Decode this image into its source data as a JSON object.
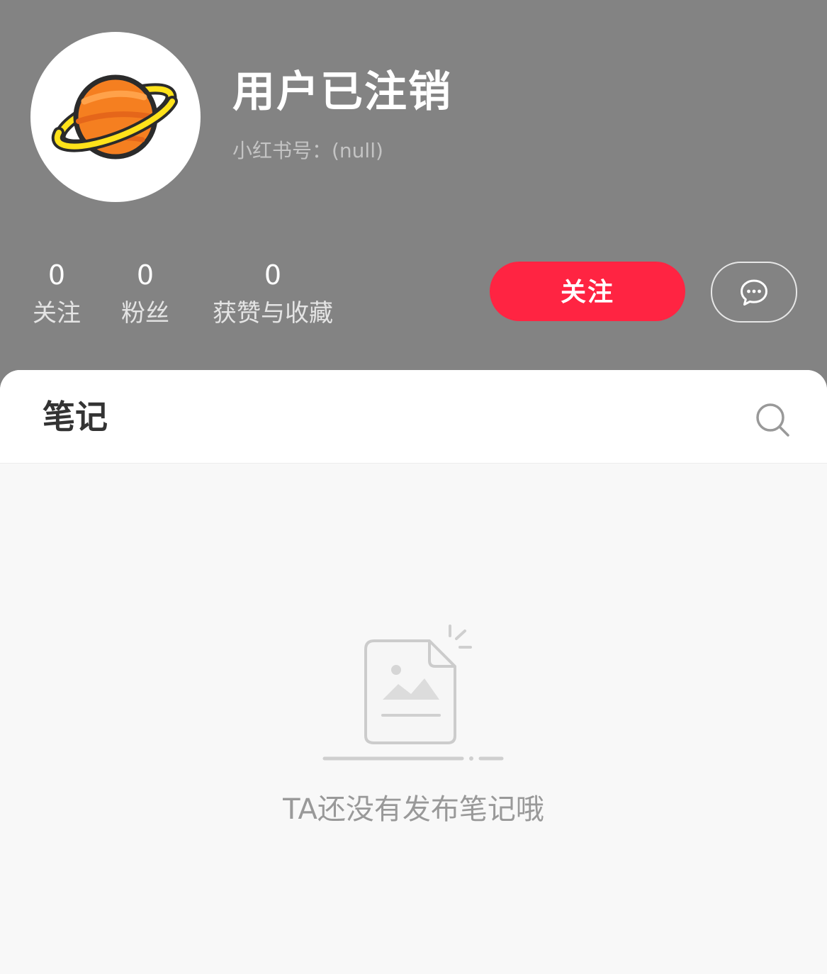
{
  "profile": {
    "username": "用户已注销",
    "user_id": "小红书号：(null)",
    "avatar_icon": "planet-icon"
  },
  "stats": [
    {
      "value": "0",
      "label": "关注"
    },
    {
      "value": "0",
      "label": "粉丝"
    },
    {
      "value": "0",
      "label": "获赞与收藏"
    }
  ],
  "actions": {
    "follow_label": "关注",
    "message_icon": "chat-bubble-icon"
  },
  "content": {
    "tab_label": "笔记",
    "search_icon": "search-icon",
    "empty_icon": "empty-note-icon",
    "empty_text": "TA还没有发布笔记哦"
  },
  "colors": {
    "header_bg": "#838383",
    "accent": "#ff2442",
    "content_bg": "#f8f8f8"
  }
}
